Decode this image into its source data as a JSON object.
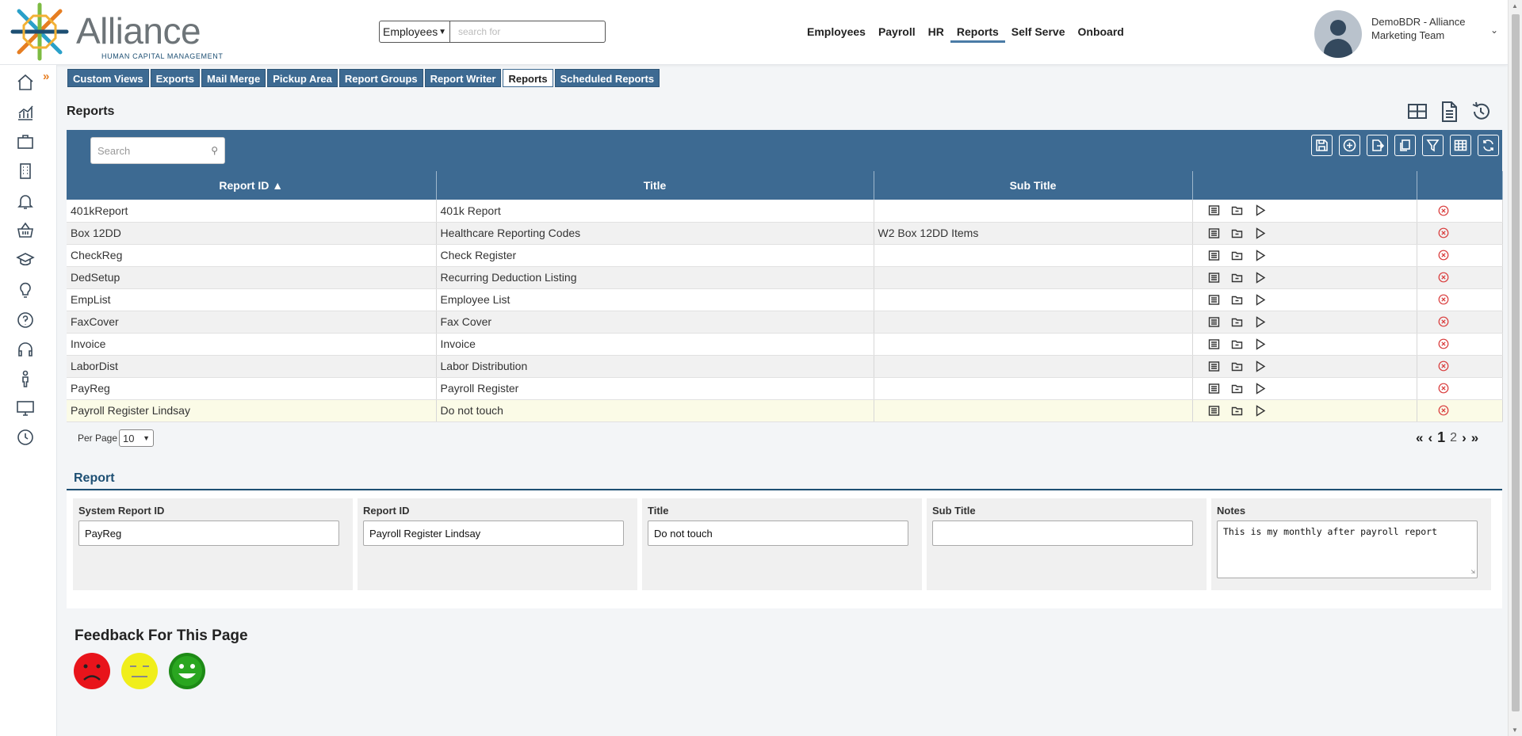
{
  "brand": {
    "name": "Alliance",
    "tagline": "HUMAN CAPITAL MANAGEMENT",
    "colors": {
      "primary": "#3d6a92",
      "accent": "#1d4f73",
      "orange": "#e67e22"
    }
  },
  "search": {
    "scope": "Employees",
    "placeholder": "search for"
  },
  "topnav": {
    "items": [
      "Employees",
      "Payroll",
      "HR",
      "Reports",
      "Self Serve",
      "Onboard"
    ],
    "active": "Reports"
  },
  "user": {
    "name_line1": "DemoBDR - Alliance",
    "name_line2": "Marketing Team"
  },
  "sidebar": {
    "icons": [
      "home-icon",
      "analytics-icon",
      "briefcase-icon",
      "building-icon",
      "bell-icon",
      "basket-icon",
      "graduation-cap-icon",
      "lightbulb-icon",
      "help-icon",
      "headset-icon",
      "person-icon",
      "monitor-icon",
      "clock-icon"
    ]
  },
  "subtabs": {
    "items": [
      "Custom Views",
      "Exports",
      "Mail Merge",
      "Pickup Area",
      "Report Groups",
      "Report Writer",
      "Reports",
      "Scheduled Reports"
    ],
    "active": "Reports"
  },
  "page": {
    "title": "Reports"
  },
  "grid": {
    "search_placeholder": "Search",
    "columns": [
      "Report ID ▲",
      "Title",
      "Sub Title",
      "",
      ""
    ],
    "rows": [
      {
        "report_id": "401kReport",
        "title": "401k Report",
        "subtitle": ""
      },
      {
        "report_id": "Box 12DD",
        "title": "Healthcare Reporting Codes",
        "subtitle": "W2 Box 12DD Items"
      },
      {
        "report_id": "CheckReg",
        "title": "Check Register",
        "subtitle": ""
      },
      {
        "report_id": "DedSetup",
        "title": "Recurring Deduction Listing",
        "subtitle": ""
      },
      {
        "report_id": "EmpList",
        "title": "Employee List",
        "subtitle": ""
      },
      {
        "report_id": "FaxCover",
        "title": "Fax Cover",
        "subtitle": ""
      },
      {
        "report_id": "Invoice",
        "title": "Invoice",
        "subtitle": ""
      },
      {
        "report_id": "LaborDist",
        "title": "Labor Distribution",
        "subtitle": ""
      },
      {
        "report_id": "PayReg",
        "title": "Payroll Register",
        "subtitle": ""
      },
      {
        "report_id": "Payroll Register Lindsay",
        "title": "Do not touch",
        "subtitle": ""
      }
    ],
    "selected_row": 9
  },
  "pagination": {
    "per_page_label": "Per Page",
    "per_page": "10",
    "current_page": "1",
    "next_page": "2"
  },
  "report": {
    "section_title": "Report",
    "fields": {
      "system_report_id": {
        "label": "System Report ID",
        "value": "PayReg"
      },
      "report_id": {
        "label": "Report ID",
        "value": "Payroll Register Lindsay"
      },
      "title": {
        "label": "Title",
        "value": "Do not touch"
      },
      "sub_title": {
        "label": "Sub Title",
        "value": ""
      },
      "notes": {
        "label": "Notes",
        "value": "This is my monthly after payroll report"
      }
    }
  },
  "feedback": {
    "title": "Feedback For This Page"
  }
}
